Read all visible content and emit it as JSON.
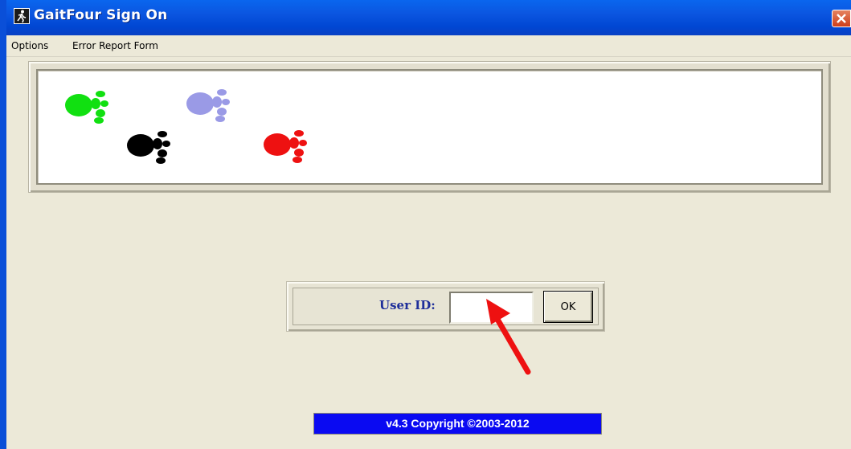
{
  "window": {
    "title": "GaitFour Sign On",
    "icon": "walking-figure-icon",
    "close_icon": "close-icon"
  },
  "menu": {
    "items": [
      {
        "label": "Options"
      },
      {
        "label": "Error Report Form"
      }
    ]
  },
  "banner": {
    "paw_colors": [
      "#11e011",
      "#9a9ae6",
      "#000000",
      "#ee1111"
    ],
    "icon": "footprint-icon"
  },
  "login": {
    "user_id_label": "User ID:",
    "user_id_value": "",
    "ok_label": "OK",
    "label_color": "#1f2f9a"
  },
  "annotation": {
    "arrow_color": "#ee1111",
    "icon": "red-arrow-icon"
  },
  "footer": {
    "copyright": "v4.3 Copyright ©2003-2012",
    "background_color": "#0a0af2"
  }
}
